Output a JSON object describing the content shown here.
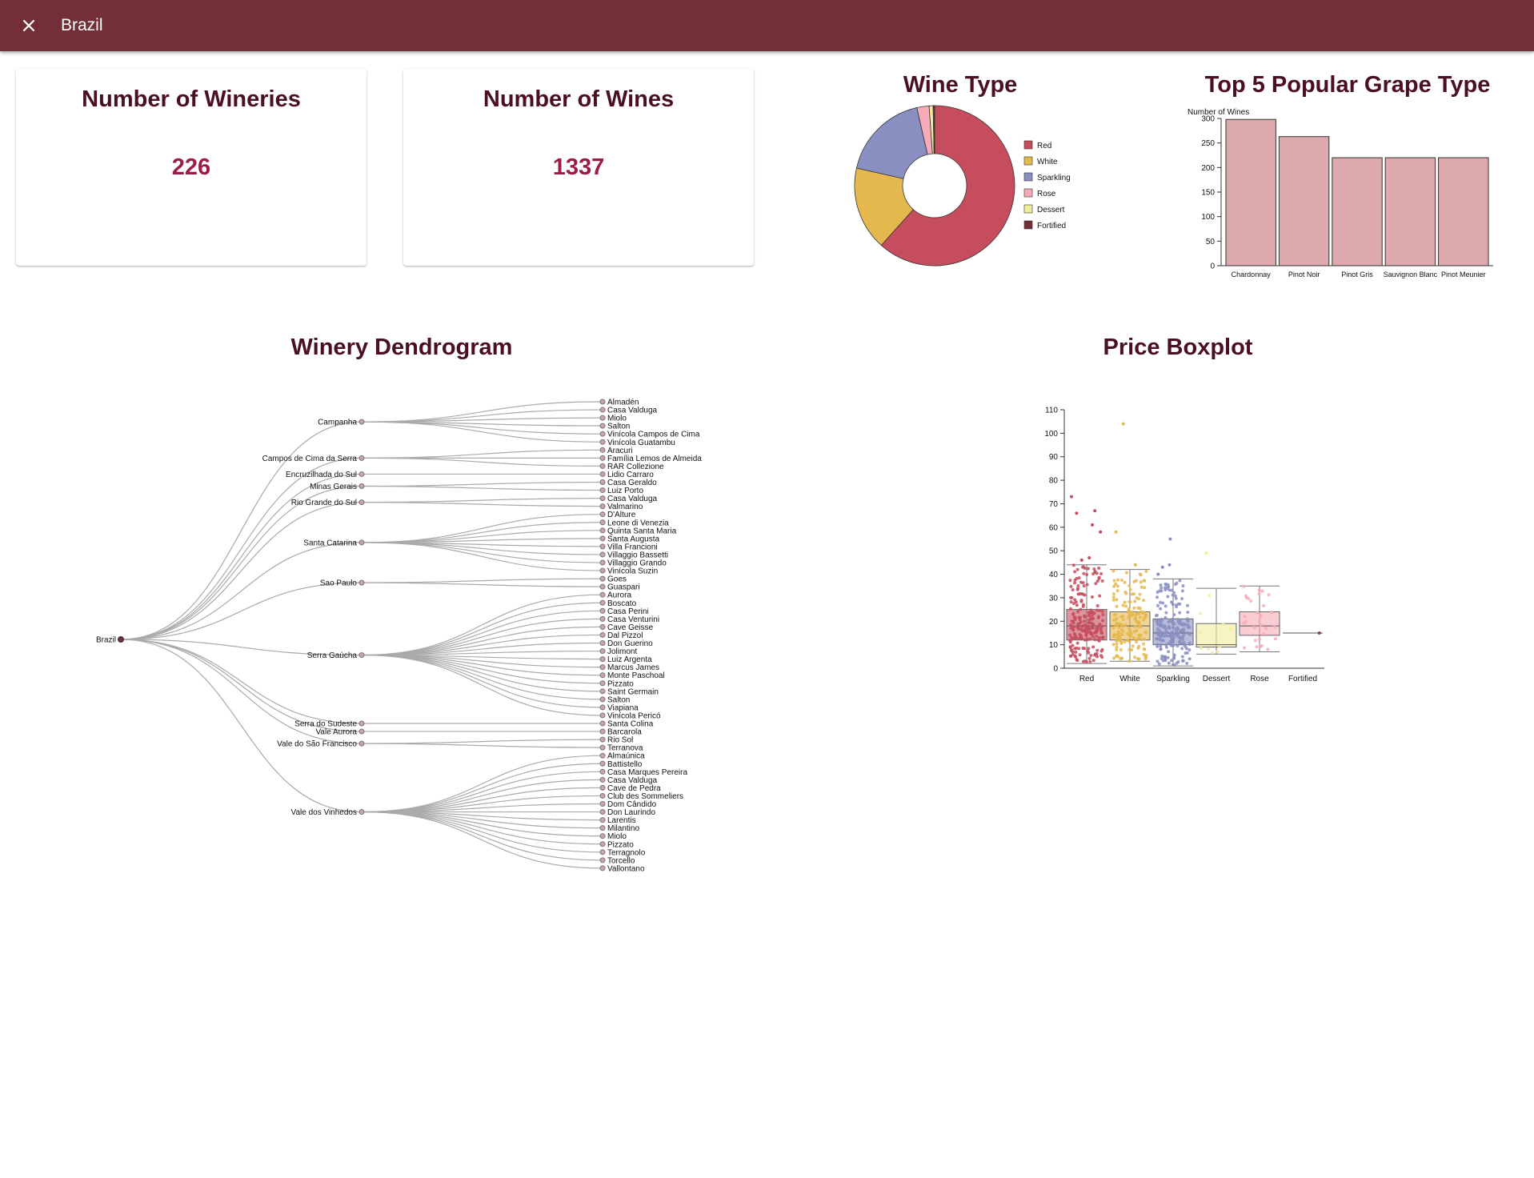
{
  "appbar": {
    "title": "Brazil",
    "close_icon": "close-icon"
  },
  "colors": {
    "appbar": "#722f37",
    "title": "#4a0f23",
    "value": "#9b1d45",
    "Red": "#c64d5e",
    "White": "#e4b84f",
    "Sparkling": "#8a8fc1",
    "Rose": "#f7aab8",
    "Dessert": "#f1ec9b",
    "Fortified": "#722f37",
    "bar": "#dea9ad"
  },
  "cards": [
    {
      "title": "Number of Wineries",
      "value": "226"
    },
    {
      "title": "Number of Wines",
      "value": "1337"
    }
  ],
  "wine_type": {
    "title": "Wine Type",
    "legend": [
      "Red",
      "White",
      "Sparkling",
      "Rose",
      "Dessert",
      "Fortified"
    ]
  },
  "grapes": {
    "title": "Top 5 Popular Grape Type",
    "ylabel": "Number of Wines"
  },
  "dendrogram": {
    "title": "Winery Dendrogram",
    "root": "Brazil",
    "regions": [
      {
        "name": "Campanha",
        "wineries": [
          "Almadén",
          "Casa Valduga",
          "Miolo",
          "Salton",
          "Vinícola Campos de Cima",
          "Vinícola Guatambu"
        ]
      },
      {
        "name": "Campos de Cima da Serra",
        "wineries": [
          "Aracuri",
          "Família Lemos de Almeida",
          "RAR Collezione"
        ]
      },
      {
        "name": "Encruzilhada do Sul",
        "wineries": [
          "Lidio Carraro"
        ]
      },
      {
        "name": "Minas Gerais",
        "wineries": [
          "Casa Geraldo",
          "Luiz Porto"
        ]
      },
      {
        "name": "Rio Grande do Sul",
        "wineries": [
          "Casa Valduga",
          "Valmarino"
        ]
      },
      {
        "name": "Santa Catarina",
        "wineries": [
          "D'Alture",
          "Leone di Venezia",
          "Quinta Santa Maria",
          "Santa Augusta",
          "Villa Francioni",
          "Villaggio Bassetti",
          "Villaggio Grando",
          "Vinícola Suzin"
        ]
      },
      {
        "name": "Sao Paulo",
        "wineries": [
          "Goes",
          "Guaspari"
        ]
      },
      {
        "name": "Serra Gaúcha",
        "wineries": [
          "Aurora",
          "Boscato",
          "Casa Perini",
          "Casa Venturini",
          "Cave Geisse",
          "Dal Pizzol",
          "Don Guerino",
          "Jolimont",
          "Luiz Argenta",
          "Marcus James",
          "Monte Paschoal",
          "Pizzato",
          "Saint Germain",
          "Salton",
          "Viapiana",
          "Vinícola Pericó"
        ]
      },
      {
        "name": "Serra do Sudeste",
        "wineries": [
          "Santa Colina"
        ]
      },
      {
        "name": "Vale Aurora",
        "wineries": [
          "Barcarola"
        ]
      },
      {
        "name": "Vale do São Francisco",
        "wineries": [
          "Rio Sol",
          "Terranova"
        ]
      },
      {
        "name": "Vale dos Vinhedos",
        "wineries": [
          "Almaúnica",
          "Battistello",
          "Casa Marques Pereira",
          "Casa Valduga",
          "Cave de Pedra",
          "Club des Sommeliers",
          "Dom Cândido",
          "Don Laurindo",
          "Larentis",
          "Milantino",
          "Miolo",
          "Pizzato",
          "Terragnolo",
          "Torcello",
          "Vallontano"
        ]
      }
    ]
  },
  "boxplot": {
    "title": "Price Boxplot"
  },
  "chart_data": [
    {
      "type": "pie",
      "title": "Wine Type",
      "donut": true,
      "categories": [
        "Red",
        "White",
        "Sparkling",
        "Rose",
        "Dessert",
        "Fortified"
      ],
      "values": [
        62,
        17,
        18,
        2.5,
        0.8,
        0.3
      ],
      "legend": "right"
    },
    {
      "type": "bar",
      "title": "Top 5 Popular Grape Type",
      "categories": [
        "Chardonnay",
        "Pinot Noir",
        "Pinot Gris",
        "Sauvignon Blanc",
        "Pinot Meunier"
      ],
      "values": [
        298,
        263,
        220,
        220,
        220
      ],
      "ylabel": "Number of Wines",
      "ylim": [
        0,
        300
      ],
      "yticks": [
        0,
        50,
        100,
        150,
        200,
        250,
        300
      ]
    },
    {
      "type": "boxplot",
      "title": "Price Boxplot",
      "categories": [
        "Red",
        "White",
        "Sparkling",
        "Dessert",
        "Rose",
        "Fortified"
      ],
      "ylim": [
        0,
        110
      ],
      "yticks": [
        0,
        10,
        20,
        30,
        40,
        50,
        60,
        70,
        80,
        90,
        100,
        110
      ],
      "boxes": [
        {
          "name": "Red",
          "min": 2,
          "q1": 12,
          "median": 18,
          "q3": 25,
          "max": 44,
          "n": 220,
          "outliers": [
            61,
            58,
            66,
            67,
            73,
            46,
            47
          ]
        },
        {
          "name": "White",
          "min": 3,
          "q1": 12,
          "median": 18,
          "q3": 24,
          "max": 42,
          "n": 170,
          "outliers": [
            104,
            58,
            44
          ]
        },
        {
          "name": "Sparkling",
          "min": 1,
          "q1": 10,
          "median": 15,
          "q3": 21,
          "max": 38,
          "n": 200,
          "outliers": [
            55,
            44,
            43,
            40
          ]
        },
        {
          "name": "Dessert",
          "min": 6,
          "q1": 9,
          "median": 10,
          "q3": 19,
          "max": 34,
          "n": 10,
          "outliers": [
            49
          ]
        },
        {
          "name": "Rose",
          "min": 7,
          "q1": 14,
          "median": 18,
          "q3": 24,
          "max": 35,
          "n": 30,
          "outliers": []
        },
        {
          "name": "Fortified",
          "min": 15,
          "q1": 15,
          "median": 15,
          "q3": 15,
          "max": 15,
          "n": 1,
          "outliers": []
        }
      ]
    }
  ]
}
